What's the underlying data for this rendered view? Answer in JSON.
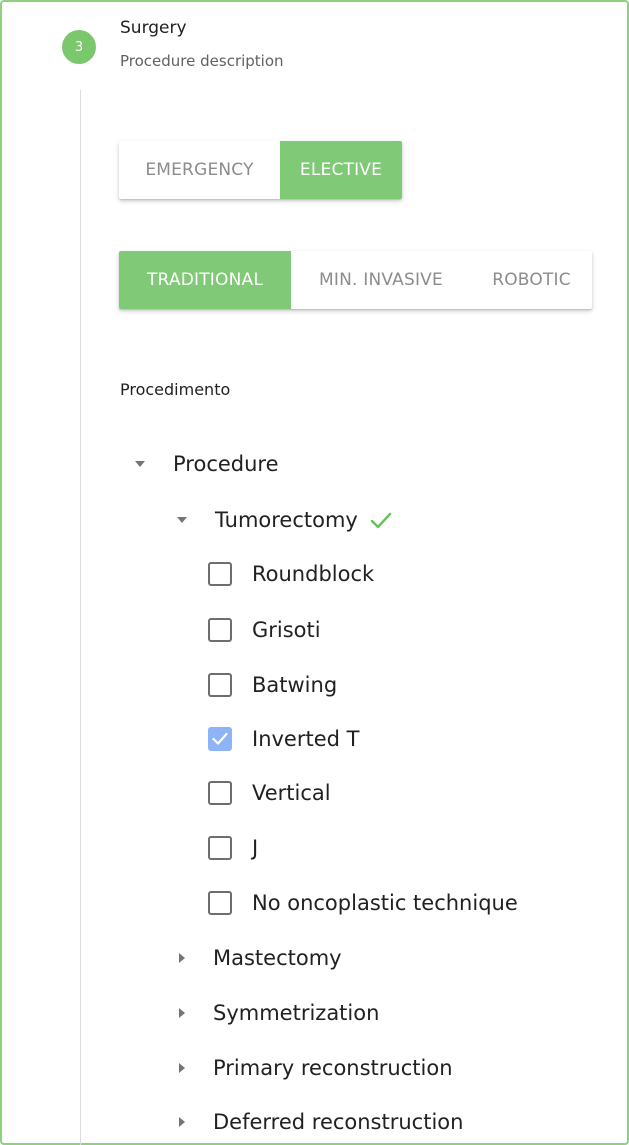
{
  "step": {
    "number": "3",
    "title": "Surgery",
    "subtitle": "Procedure description"
  },
  "urgency": {
    "options": [
      "EMERGENCY",
      "ELECTIVE"
    ],
    "selected": "ELECTIVE"
  },
  "technique": {
    "options": [
      "TRADITIONAL",
      "MIN. INVASIVE",
      "ROBOTIC"
    ],
    "selected": "TRADITIONAL"
  },
  "section_label": "Procedimento",
  "tree": {
    "root": "Procedure",
    "tumorectomy": {
      "label": "Tumorectomy",
      "items": [
        {
          "label": "Roundblock",
          "checked": false
        },
        {
          "label": "Grisoti",
          "checked": false
        },
        {
          "label": "Batwing",
          "checked": false
        },
        {
          "label": "Inverted T",
          "checked": true
        },
        {
          "label": "Vertical",
          "checked": false
        },
        {
          "label": "J",
          "checked": false
        },
        {
          "label": "No oncoplastic technique",
          "checked": false
        }
      ]
    },
    "collapsed": [
      "Mastectomy",
      "Symmetrization",
      "Primary reconstruction",
      "Deferred reconstruction"
    ]
  },
  "colors": {
    "accent_green": "#80c977",
    "checkbox_blue": "#8db4f7",
    "frame_border": "#8fd17e"
  },
  "icons": {
    "expanded": "caret-down-icon",
    "collapsed": "caret-right-icon",
    "complete": "checkmark-icon"
  }
}
